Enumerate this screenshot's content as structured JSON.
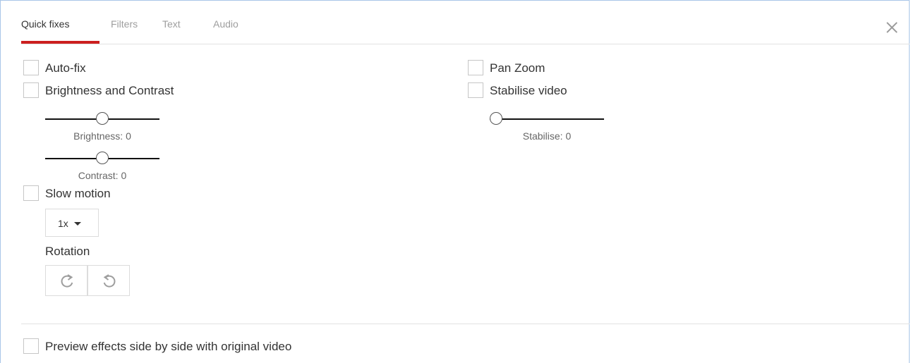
{
  "tabs": [
    {
      "label": "Quick fixes",
      "active": true
    },
    {
      "label": "Filters",
      "active": false
    },
    {
      "label": "Text",
      "active": false
    },
    {
      "label": "Audio",
      "active": false
    }
  ],
  "close_icon": "close-icon",
  "left_options": {
    "auto_fix": {
      "label": "Auto-fix",
      "checked": false
    },
    "brightness_contrast": {
      "label": "Brightness and Contrast",
      "checked": false
    },
    "brightness": {
      "label": "Brightness: 0",
      "value": 0,
      "fraction": 0.5
    },
    "contrast": {
      "label": "Contrast: 0",
      "value": 0,
      "fraction": 0.5
    },
    "slow_motion": {
      "label": "Slow motion",
      "checked": false
    },
    "slow_motion_speed": "1x",
    "rotation_label": "Rotation",
    "rotate_right_icon": "rotate-clockwise-icon",
    "rotate_left_icon": "rotate-counterclockwise-icon"
  },
  "right_options": {
    "pan_zoom": {
      "label": "Pan Zoom",
      "checked": false
    },
    "stabilise_video": {
      "label": "Stabilise video",
      "checked": false
    },
    "stabilise": {
      "label": "Stabilise: 0",
      "value": 0,
      "fraction": 0
    }
  },
  "preview": {
    "label": "Preview effects side by side with original video",
    "checked": false
  },
  "colors": {
    "accent": "#cc1f1f",
    "window_border": "#a9c6e8"
  }
}
